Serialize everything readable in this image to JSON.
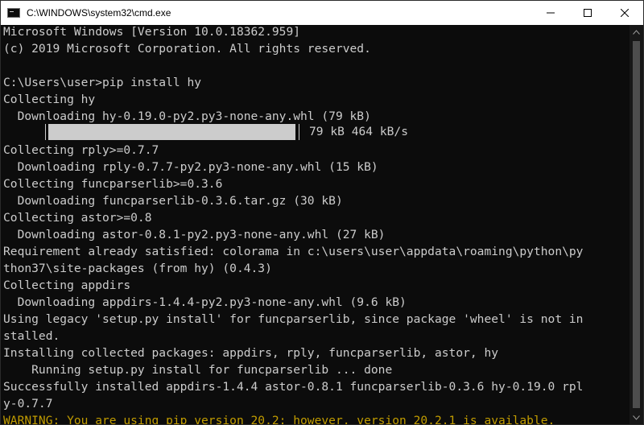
{
  "window": {
    "title": "C:\\WINDOWS\\system32\\cmd.exe"
  },
  "console": {
    "lines": [
      "Microsoft Windows [Version 10.0.18362.959]",
      "(c) 2019 Microsoft Corporation. All rights reserved.",
      "",
      "C:\\Users\\user>pip install hy",
      "Collecting hy",
      "  Downloading hy-0.19.0-py2.py3-none-any.whl (79 kB)",
      "",
      "Collecting rply>=0.7.7",
      "  Downloading rply-0.7.7-py2.py3-none-any.whl (15 kB)",
      "Collecting funcparserlib>=0.3.6",
      "  Downloading funcparserlib-0.3.6.tar.gz (30 kB)",
      "Collecting astor>=0.8",
      "  Downloading astor-0.8.1-py2.py3-none-any.whl (27 kB)",
      "Requirement already satisfied: colorama in c:\\users\\user\\appdata\\roaming\\python\\py",
      "thon37\\site-packages (from hy) (0.4.3)",
      "Collecting appdirs",
      "  Downloading appdirs-1.4.4-py2.py3-none-any.whl (9.6 kB)",
      "Using legacy 'setup.py install' for funcparserlib, since package 'wheel' is not in",
      "stalled.",
      "Installing collected packages: appdirs, rply, funcparserlib, astor, hy",
      "    Running setup.py install for funcparserlib ... done",
      "Successfully installed appdirs-1.4.4 astor-0.8.1 funcparserlib-0.3.6 hy-0.19.0 rpl",
      "y-0.7.7"
    ],
    "warning": "WARNING: You are using pip version 20.2; however, version 20.2.1 is available.",
    "progress": {
      "fraction": 1.0,
      "text": "79 kB 464 kB/s"
    }
  },
  "colors": {
    "background": "#0c0c0c",
    "text": "#cccccc",
    "warning": "#c19c00",
    "titlebar": "#ffffff"
  },
  "icons": {
    "app": "cmd-icon",
    "minimize": "minimize-icon",
    "maximize": "maximize-icon",
    "close": "close-icon"
  }
}
